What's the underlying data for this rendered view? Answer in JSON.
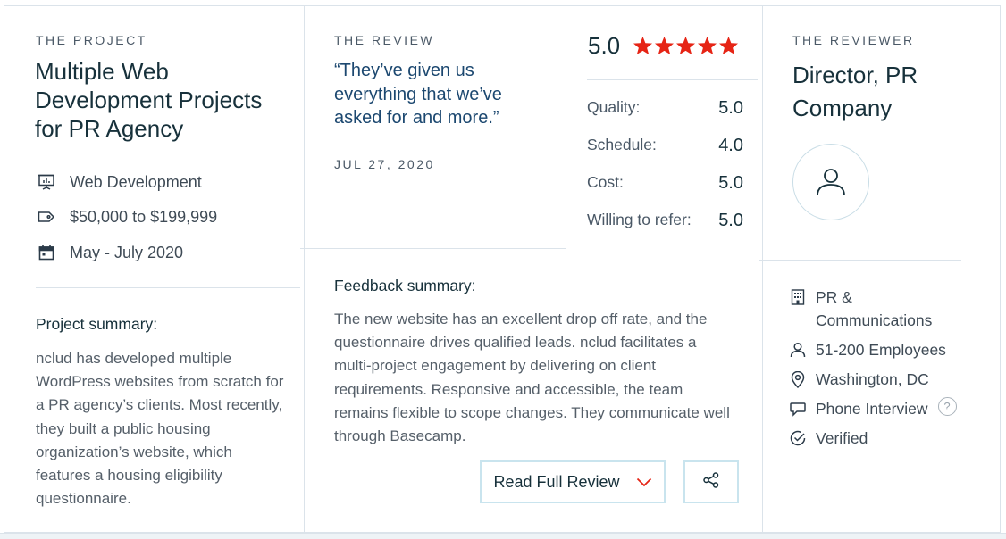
{
  "project": {
    "eyebrow": "THE PROJECT",
    "title": "Multiple Web Development Projects for PR Agency",
    "service": "Web Development",
    "budget": "$50,000 to $199,999",
    "dates": "May - July 2020",
    "summary_heading": "Project summary:",
    "summary": "nclud has developed multiple WordPress websites from scratch for a PR agency’s clients. Most recently, they built a public housing organization’s website, which features a housing eligibility questionnaire."
  },
  "review": {
    "eyebrow": "THE REVIEW",
    "quote": "“They’ve given us everything that we’ve asked for and more.”",
    "date": "JUL 27, 2020",
    "overall": "5.0",
    "stars": 5,
    "ratings": [
      {
        "label": "Quality:",
        "value": "5.0"
      },
      {
        "label": "Schedule:",
        "value": "4.0"
      },
      {
        "label": "Cost:",
        "value": "5.0"
      },
      {
        "label": "Willing to refer:",
        "value": "5.0"
      }
    ],
    "feedback_heading": "Feedback summary:",
    "feedback": "The new website has an excellent drop off rate, and the questionnaire drives qualified leads. nclud facilitates a multi-project engagement by delivering on client requirements. Responsive and accessible, the team remains flexible to scope changes. They communicate well through Basecamp.",
    "read_button": "Read Full Review",
    "icons": {
      "star": "star-icon",
      "chevron": "chevron-down-icon",
      "share": "share-icon"
    }
  },
  "reviewer": {
    "eyebrow": "THE REVIEWER",
    "title": "Director, PR Company",
    "industry": "PR & Communications",
    "size": "51-200 Employees",
    "location": "Washington, DC",
    "interview": "Phone Interview",
    "help": "?",
    "verified": "Verified"
  },
  "colors": {
    "accent_red": "#e62415",
    "border": "#dbe3ea",
    "button_border": "#c9e4ee",
    "quote_blue": "#1c4870"
  }
}
